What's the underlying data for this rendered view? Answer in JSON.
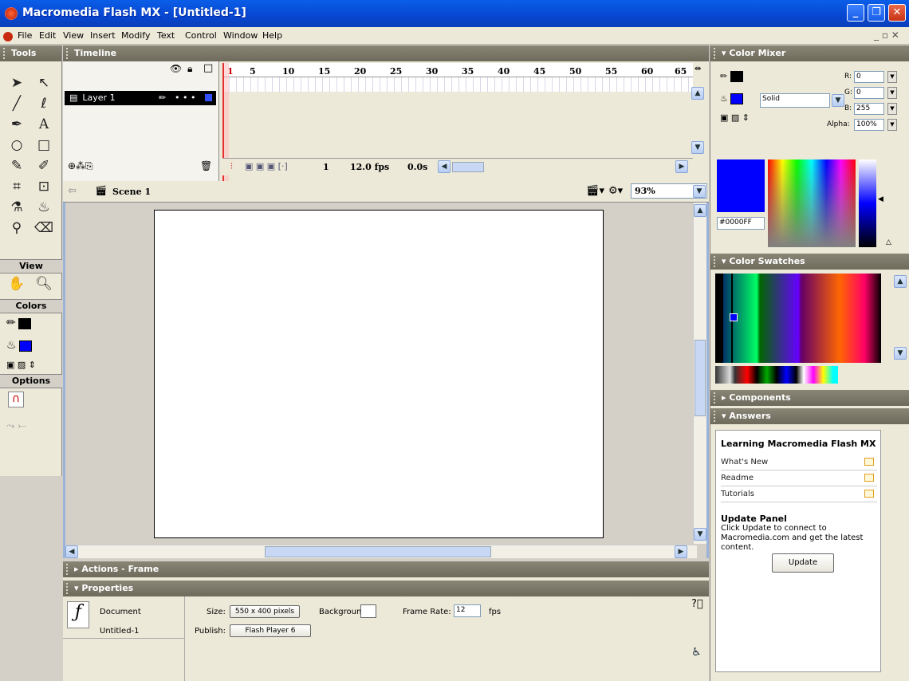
{
  "window": {
    "title": "Macromedia Flash MX - [Untitled-1]"
  },
  "menu": [
    "File",
    "Edit",
    "View",
    "Insert",
    "Modify",
    "Text",
    "Control",
    "Window",
    "Help"
  ],
  "tools": {
    "header": "Tools",
    "view": "View",
    "colors": "Colors",
    "options": "Options"
  },
  "timeline": {
    "header": "Timeline",
    "layer_name": "Layer 1",
    "ruler": [
      "1",
      "5",
      "10",
      "15",
      "20",
      "25",
      "30",
      "35",
      "40",
      "45",
      "50",
      "55",
      "60",
      "65"
    ],
    "frame": "1",
    "fps": "12.0 fps",
    "time": "0.0s"
  },
  "scene": {
    "name": "Scene 1",
    "zoom": "93%"
  },
  "panels": {
    "actions": "Actions - Frame",
    "properties": "Properties"
  },
  "properties": {
    "doc_label": "Document",
    "doc_name": "Untitled-1",
    "size_label": "Size:",
    "size_value": "550 x 400 pixels",
    "background_label": "Background:",
    "framerate_label": "Frame Rate:",
    "framerate_value": "12",
    "fps_unit": "fps",
    "publish_label": "Publish:",
    "publish_value": "Flash Player 6"
  },
  "color_mixer": {
    "header": "Color Mixer",
    "r_label": "R:",
    "r": "0",
    "g_label": "G:",
    "g": "0",
    "b_label": "B:",
    "b": "255",
    "alpha_label": "Alpha:",
    "alpha": "100%",
    "fill_type": "Solid",
    "hex": "#0000FF",
    "fill_color": "#0000ff"
  },
  "swatches": {
    "header": "Color Swatches"
  },
  "components": {
    "header": "Components"
  },
  "answers": {
    "header": "Answers",
    "title": "Learning Macromedia Flash MX",
    "links": [
      "What's New",
      "Readme",
      "Tutorials"
    ],
    "update_title": "Update Panel",
    "update_text": "Click Update to connect to Macromedia.com and get the latest content.",
    "update_button": "Update"
  }
}
